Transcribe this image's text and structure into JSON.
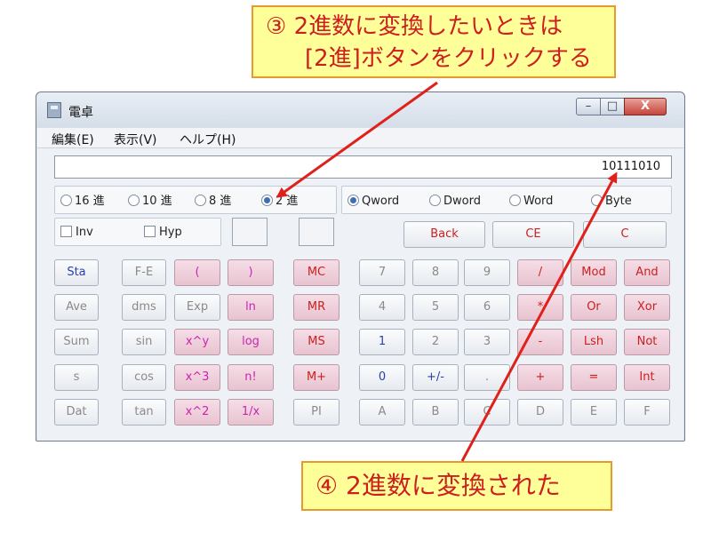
{
  "callouts": {
    "top_line1": "③ 2進数に変換したいときは",
    "top_line2": "[2進]ボタンをクリックする",
    "bottom": "④ 2進数に変換された"
  },
  "window": {
    "title": "電卓",
    "controls": {
      "minimize": "–",
      "maximize": "□",
      "close": "X"
    }
  },
  "menu": [
    "編集(E)",
    "表示(V)",
    "ヘルプ(H)"
  ],
  "display": {
    "value": "10111010"
  },
  "base_radios": [
    {
      "label": "16 進",
      "selected": false
    },
    {
      "label": "10 進",
      "selected": false
    },
    {
      "label": "8 進",
      "selected": false
    },
    {
      "label": "2 進",
      "selected": true
    }
  ],
  "word_radios": [
    {
      "label": "Qword",
      "selected": true
    },
    {
      "label": "Dword",
      "selected": false
    },
    {
      "label": "Word",
      "selected": false
    },
    {
      "label": "Byte",
      "selected": false
    }
  ],
  "checks": {
    "inv": "Inv",
    "hyp": "Hyp"
  },
  "top_buttons": [
    "Back",
    "CE",
    "C"
  ],
  "sci_cols": [
    [
      "Sta",
      "Ave",
      "Sum",
      "s",
      "Dat"
    ],
    [
      "F-E",
      "dms",
      "sin",
      "cos",
      "tan"
    ],
    [
      "(",
      "Exp",
      "x^y",
      "x^3",
      "x^2"
    ],
    [
      ")",
      "ln",
      "log",
      "n!",
      "1/x"
    ]
  ],
  "memory": [
    "MC",
    "MR",
    "MS",
    "M+",
    "PI"
  ],
  "keypad_rows": [
    [
      "7",
      "8",
      "9",
      "/",
      "Mod",
      "And"
    ],
    [
      "4",
      "5",
      "6",
      "*",
      "Or",
      "Xor"
    ],
    [
      "1",
      "2",
      "3",
      "-",
      "Lsh",
      "Not"
    ],
    [
      "0",
      "+/-",
      ".",
      "+",
      "=",
      "Int"
    ],
    [
      "A",
      "B",
      "C",
      "D",
      "E",
      "F"
    ]
  ],
  "colors": {
    "callout_bg": "#ffff99",
    "callout_text": "#cc1f1f",
    "arrow": "#e0201a"
  }
}
